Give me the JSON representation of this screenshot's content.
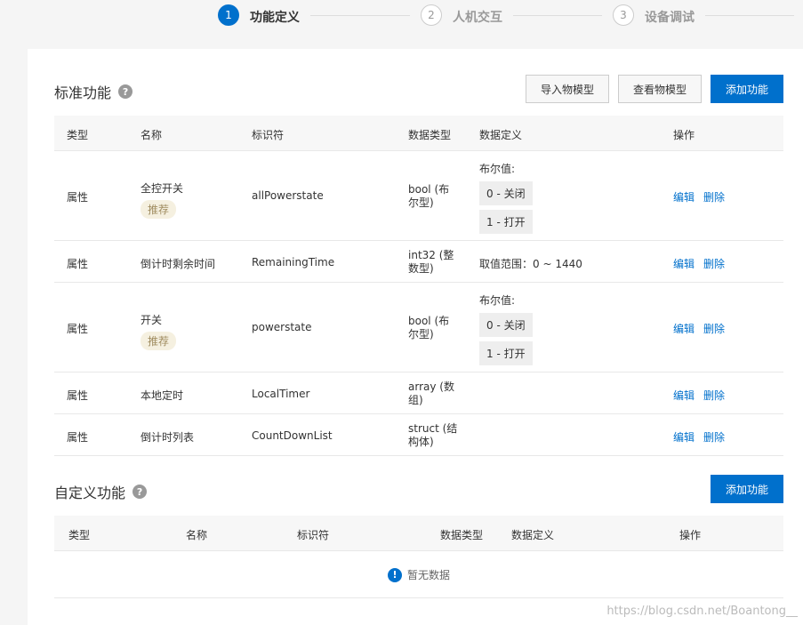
{
  "steps": [
    {
      "number": "1",
      "label": "功能定义",
      "state": "active"
    },
    {
      "number": "2",
      "label": "人机交互",
      "state": "inactive"
    },
    {
      "number": "3",
      "label": "设备调试",
      "state": "inactive"
    }
  ],
  "standard": {
    "title": "标准功能",
    "help": "?",
    "buttons": {
      "import": "导入物模型",
      "view": "查看物模型",
      "add": "添加功能"
    },
    "columns": [
      "类型",
      "名称",
      "标识符",
      "数据类型",
      "数据定义",
      "操作"
    ],
    "rows": [
      {
        "type": "属性",
        "name": "全控开关",
        "tag": "推荐",
        "identifier": "allPowerstate",
        "dtype_1": "bool (布",
        "dtype_2": "尔型)",
        "def_title": "布尔值:",
        "def_0": "0 - 关闭",
        "def_1": "1 - 打开",
        "edit": "编辑",
        "delete": "删除"
      },
      {
        "type": "属性",
        "name": "倒计时剩余时间",
        "identifier": "RemainingTime",
        "dtype_1": "int32 (整",
        "dtype_2": "数型)",
        "def_range": "取值范围：0 ~ 1440",
        "edit": "编辑",
        "delete": "删除"
      },
      {
        "type": "属性",
        "name": "开关",
        "tag": "推荐",
        "identifier": "powerstate",
        "dtype_1": "bool (布",
        "dtype_2": "尔型)",
        "def_title": "布尔值:",
        "def_0": "0 - 关闭",
        "def_1": "1 - 打开",
        "edit": "编辑",
        "delete": "删除"
      },
      {
        "type": "属性",
        "name": "本地定时",
        "identifier": "LocalTimer",
        "dtype_1": "array (数",
        "dtype_2": "组)",
        "edit": "编辑",
        "delete": "删除"
      },
      {
        "type": "属性",
        "name": "倒计时列表",
        "identifier": "CountDownList",
        "dtype_1": "struct (结",
        "dtype_2": "构体)",
        "edit": "编辑",
        "delete": "删除"
      }
    ]
  },
  "custom": {
    "title": "自定义功能",
    "help": "?",
    "add": "添加功能",
    "columns": [
      "类型",
      "名称",
      "标识符",
      "数据类型",
      "数据定义",
      "操作"
    ],
    "empty_icon": "!",
    "empty_text": "暂无数据"
  },
  "watermark": "https://blog.csdn.net/Boantong__",
  "colors": {
    "primary": "#0070cc",
    "tag_bg": "#f5f0e0",
    "tag_text": "#a08c60"
  }
}
